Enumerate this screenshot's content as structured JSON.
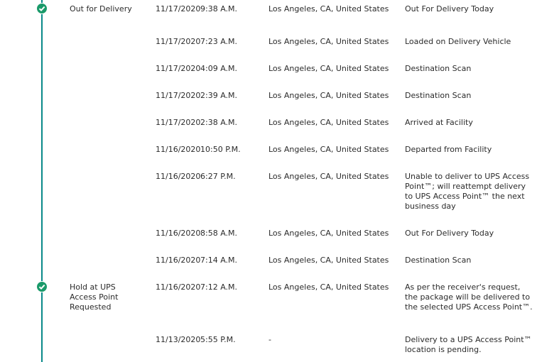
{
  "colors": {
    "timeline": "#0a8a8a",
    "check_fill": "#1a9a6a",
    "text": "#2b2b2b"
  },
  "events": [
    {
      "milestone": "Out for Delivery",
      "date": "11/17/2020",
      "time": "9:38 A.M.",
      "location": "Los Angeles, CA, United States",
      "activity": "Out For Delivery Today",
      "check_icon": "check-circle-icon"
    },
    {
      "milestone": "",
      "date": "11/17/2020",
      "time": "7:23 A.M.",
      "location": "Los Angeles, CA, United States",
      "activity": "Loaded on Delivery Vehicle"
    },
    {
      "milestone": "",
      "date": "11/17/2020",
      "time": "4:09 A.M.",
      "location": "Los Angeles, CA, United States",
      "activity": "Destination Scan"
    },
    {
      "milestone": "",
      "date": "11/17/2020",
      "time": "2:39 A.M.",
      "location": "Los Angeles, CA, United States",
      "activity": "Destination Scan"
    },
    {
      "milestone": "",
      "date": "11/17/2020",
      "time": "2:38 A.M.",
      "location": "Los Angeles, CA, United States",
      "activity": "Arrived at Facility"
    },
    {
      "milestone": "",
      "date": "11/16/2020",
      "time": "10:50 P.M.",
      "location": "Los Angeles, CA, United States",
      "activity": "Departed from Facility"
    },
    {
      "milestone": "",
      "date": "11/16/2020",
      "time": "6:27 P.M.",
      "location": "Los Angeles, CA, United States",
      "activity": "Unable to deliver to UPS Access Point™; will reattempt delivery to UPS Access Point™ the next business day"
    },
    {
      "milestone": "",
      "date": "11/16/2020",
      "time": "8:58 A.M.",
      "location": "Los Angeles, CA, United States",
      "activity": "Out For Delivery Today"
    },
    {
      "milestone": "",
      "date": "11/16/2020",
      "time": "7:14 A.M.",
      "location": "Los Angeles, CA, United States",
      "activity": "Destination Scan"
    },
    {
      "milestone": "Hold at UPS Access Point Requested",
      "date": "11/16/2020",
      "time": "7:12 A.M.",
      "location": "Los Angeles, CA, United States",
      "activity": "As per the receiver's request, the package will be delivered to the selected UPS Access Point™.",
      "check_icon": "check-circle-icon"
    },
    {
      "milestone": "",
      "date": "11/13/2020",
      "time": "5:55 P.M.",
      "location": "-",
      "activity": "Delivery to a UPS Access Point™ location is pending."
    }
  ]
}
